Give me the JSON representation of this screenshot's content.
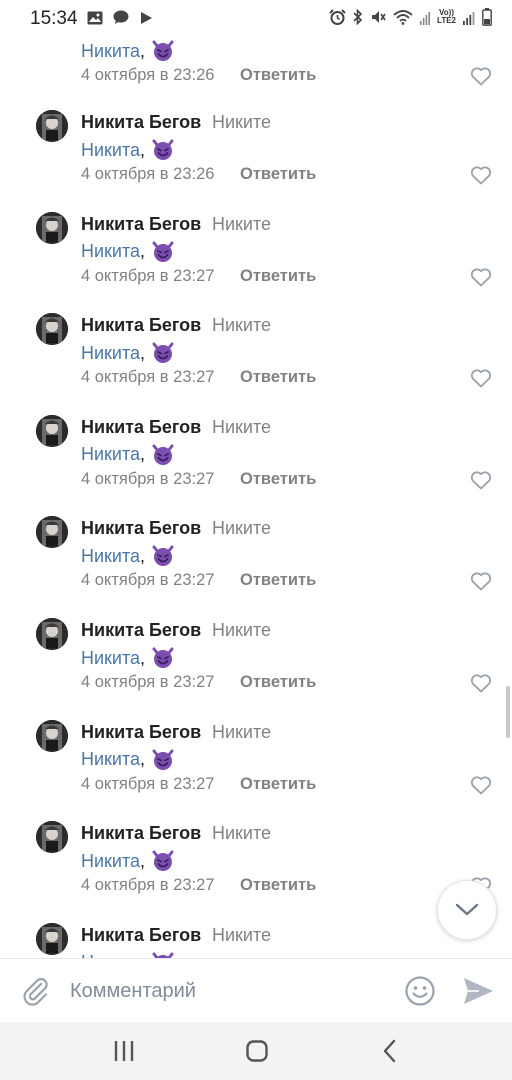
{
  "status_bar": {
    "time": "15:34",
    "left_icons": [
      "image-icon",
      "chat-icon",
      "play-icon"
    ],
    "right_icons": [
      "alarm-icon",
      "bluetooth-icon",
      "mute-icon",
      "wifi-icon",
      "volte-icon",
      "signal-icon",
      "battery-icon"
    ],
    "volte_top": "Vo))",
    "volte_bottom": "LTE2"
  },
  "partial_top": {
    "mention": "Никита",
    "comma": ",",
    "date": "4 октября в 23:26",
    "reply_label": "Ответить"
  },
  "comments": [
    {
      "author": "Никита Бегов",
      "reply_to": "Никите",
      "mention": "Никита",
      "comma": ",",
      "date": "4 октября в 23:26",
      "reply_label": "Ответить"
    },
    {
      "author": "Никита Бегов",
      "reply_to": "Никите",
      "mention": "Никита",
      "comma": ",",
      "date": "4 октября в 23:27",
      "reply_label": "Ответить"
    },
    {
      "author": "Никита Бегов",
      "reply_to": "Никите",
      "mention": "Никита",
      "comma": ",",
      "date": "4 октября в 23:27",
      "reply_label": "Ответить"
    },
    {
      "author": "Никита Бегов",
      "reply_to": "Никите",
      "mention": "Никита",
      "comma": ",",
      "date": "4 октября в 23:27",
      "reply_label": "Ответить"
    },
    {
      "author": "Никита Бегов",
      "reply_to": "Никите",
      "mention": "Никита",
      "comma": ",",
      "date": "4 октября в 23:27",
      "reply_label": "Ответить"
    },
    {
      "author": "Никита Бегов",
      "reply_to": "Никите",
      "mention": "Никита",
      "comma": ",",
      "date": "4 октября в 23:27",
      "reply_label": "Ответить"
    },
    {
      "author": "Никита Бегов",
      "reply_to": "Никите",
      "mention": "Никита",
      "comma": ",",
      "date": "4 октября в 23:27",
      "reply_label": "Ответить"
    },
    {
      "author": "Никита Бегов",
      "reply_to": "Никите",
      "mention": "Никита",
      "comma": ",",
      "date": "4 октября в 23:27",
      "reply_label": "Ответить"
    },
    {
      "author": "Никита Бегов",
      "reply_to": "Никите",
      "mention": "Никита",
      "comma": ",",
      "date": "",
      "reply_label": ""
    }
  ],
  "composer": {
    "placeholder": "Комментарий"
  },
  "colors": {
    "link": "#4a76a8",
    "secondary_text": "#828282",
    "emoji_purple": "#7b4fb0"
  }
}
